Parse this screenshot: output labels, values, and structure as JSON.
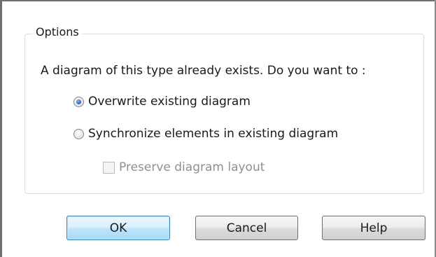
{
  "options_group": {
    "legend": "Options",
    "prompt": "A diagram of this type already exists. Do you want to :",
    "radio_overwrite": {
      "label": "Overwrite existing diagram",
      "checked": true
    },
    "radio_synchronize": {
      "label": "Synchronize elements in existing diagram",
      "checked": false
    },
    "checkbox_preserve": {
      "label": "Preserve diagram layout",
      "checked": false,
      "enabled": false
    }
  },
  "buttons": {
    "ok": "OK",
    "cancel": "Cancel",
    "help": "Help"
  },
  "colors": {
    "default_button_border": "#3c7fb1",
    "disabled_text": "#8f8f8f",
    "group_border": "#d5dfe5"
  }
}
